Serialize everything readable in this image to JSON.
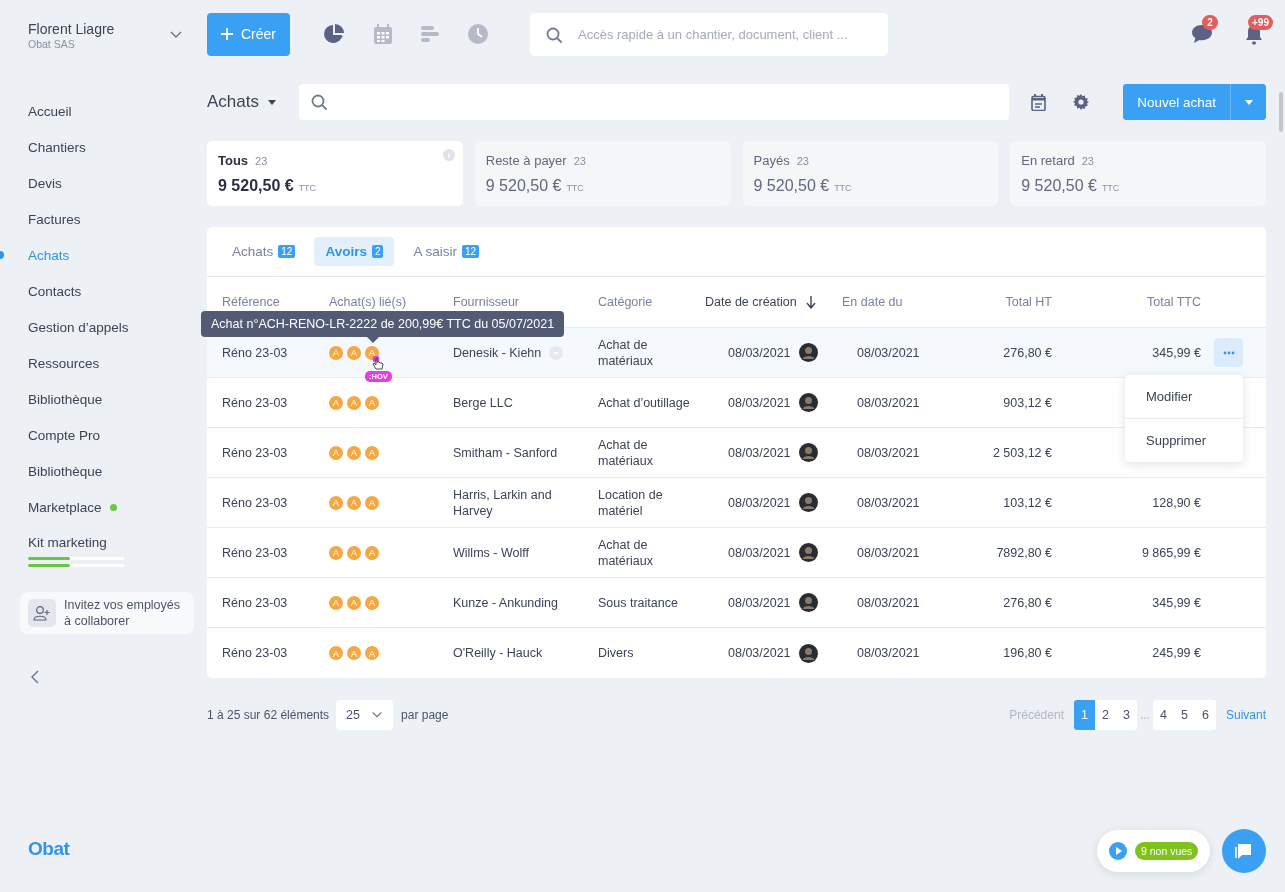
{
  "user": {
    "name": "Florent Liagre",
    "company": "Obat SAS"
  },
  "sidebar": {
    "items": [
      {
        "label": "Accueil",
        "selected": false
      },
      {
        "label": "Chantiers",
        "selected": false
      },
      {
        "label": "Devis",
        "selected": false
      },
      {
        "label": "Factures",
        "selected": false
      },
      {
        "label": "Achats",
        "selected": true
      },
      {
        "label": "Contacts",
        "selected": false
      },
      {
        "label": "Gestion d’appels",
        "selected": false
      },
      {
        "label": "Ressources",
        "selected": false
      },
      {
        "label": "Bibliothèque",
        "selected": false
      },
      {
        "label": "Compte Pro",
        "selected": false
      },
      {
        "label": "Bibliothèque",
        "selected": false
      },
      {
        "label": "Marketplace",
        "selected": false,
        "color": "#6cc644"
      },
      {
        "label": "Kit marketing",
        "selected": false,
        "progress": [
          {
            "level": 0.44
          },
          {
            "level": 0.44
          }
        ]
      }
    ],
    "invite": "Invitez vos employés à collaborer",
    "logo": "Obat"
  },
  "topbar": {
    "create_button": "Créer",
    "search_placeholder": "Accès rapide à un chantier, document, client ...",
    "messages_badge": "2",
    "notifications_badge": "+99"
  },
  "header": {
    "title": "Achats",
    "new_button": "Nouvel achat"
  },
  "cards": [
    {
      "label": "Tous",
      "count": "23",
      "amount": "9 520,50 €",
      "unit": "TTC",
      "selected": true
    },
    {
      "label": "Reste à payer",
      "count": "23",
      "amount": "9 520,50 €",
      "unit": "TTC",
      "selected": false
    },
    {
      "label": "Payés",
      "count": "23",
      "amount": "9 520,50 €",
      "unit": "TTC",
      "selected": false
    },
    {
      "label": "En retard",
      "count": "23",
      "amount": "9 520,50 €",
      "unit": "TTC",
      "selected": false
    }
  ],
  "tabs": [
    {
      "label": "Achats",
      "count": "12",
      "selected": false
    },
    {
      "label": "Avoirs",
      "count": "2",
      "selected": true
    },
    {
      "label": "A saisir",
      "count": "12",
      "selected": false
    }
  ],
  "table": {
    "columns": [
      {
        "label": "Référence",
        "sorted": false
      },
      {
        "label": "Achat(s) lié(s)",
        "sorted": false
      },
      {
        "label": "Fournisseur",
        "sorted": false
      },
      {
        "label": "Catégorie",
        "sorted": false
      },
      {
        "label": "Date de création",
        "sorted": true
      },
      {
        "label": "En date du",
        "sorted": false
      },
      {
        "label": "Total HT",
        "sorted": false
      },
      {
        "label": "Total TTC",
        "sorted": false
      }
    ],
    "rows": [
      {
        "reference": "Réno 23-03",
        "linked": [
          "A",
          "A",
          "A"
        ],
        "supplier": "Denesik - Kiehn",
        "category": "Achat de matériaux",
        "created": "08/03/2021",
        "date": "08/03/2021",
        "total_ht": "276,80 €",
        "total_ttc": "345,99 €",
        "selected": true
      },
      {
        "reference": "Réno 23-03",
        "linked": [
          "A",
          "A",
          "A"
        ],
        "supplier": "Berge LLC",
        "category": "Achat d’outillage",
        "created": "08/03/2021",
        "date": "08/03/2021",
        "total_ht": "903,12 €",
        "selected": false
      },
      {
        "reference": "Réno 23-03",
        "linked": [
          "A",
          "A",
          "A"
        ],
        "supplier": "Smitham - Sanford",
        "category": "Achat de matériaux",
        "created": "08/03/2021",
        "date": "08/03/2021",
        "total_ht": "2 503,12 €",
        "selected": false
      },
      {
        "reference": "Réno 23-03",
        "linked": [
          "A",
          "A",
          "A"
        ],
        "supplier": "Harris, Larkin and Harvey",
        "category": "Location de matériel",
        "created": "08/03/2021",
        "date": "08/03/2021",
        "total_ht": "103,12 €",
        "total_ttc": "128,90 €",
        "selected": false
      },
      {
        "reference": "Réno 23-03",
        "linked": [
          "A",
          "A",
          "A"
        ],
        "supplier": "Willms - Wolff",
        "category": "Achat de matériaux",
        "created": "08/03/2021",
        "date": "08/03/2021",
        "total_ht": "7892,80 €",
        "total_ttc": "9 865,99 €",
        "selected": false
      },
      {
        "reference": "Réno 23-03",
        "linked": [
          "A",
          "A",
          "A"
        ],
        "supplier": "Kunze - Ankunding",
        "category": "Sous traitance",
        "created": "08/03/2021",
        "date": "08/03/2021",
        "total_ht": "276,80 €",
        "total_ttc": "345,99 €",
        "selected": false
      },
      {
        "reference": "Réno 23-03",
        "linked": [
          "A",
          "A",
          "A"
        ],
        "supplier": "O'Reilly - Hauck",
        "category": "Divers",
        "created": "08/03/2021",
        "date": "08/03/2021",
        "total_ht": "196,80 €",
        "total_ttc": "245,99 €",
        "selected": false
      }
    ],
    "tooltip": "Achat n°ACH-RENO-LR-2222 de 200,99€ TTC du 05/07/2021",
    "hover_badge": ":HOV",
    "menu": [
      "Modifier",
      "Supprimer"
    ]
  },
  "pagination": {
    "summary": "1 à 25 sur 62 éléments",
    "per_page": "25",
    "per_page_label": "par page",
    "previous": "Précédent",
    "pages": [
      {
        "kind": "page",
        "label": "1",
        "selected": true
      },
      {
        "kind": "page",
        "label": "2",
        "selected": false
      },
      {
        "kind": "page",
        "label": "3",
        "selected": false
      },
      {
        "kind": "ellipsis",
        "label": "..."
      },
      {
        "kind": "page",
        "label": "4",
        "selected": false
      },
      {
        "kind": "page",
        "label": "5",
        "selected": false
      },
      {
        "kind": "page",
        "label": "6",
        "selected": false
      }
    ],
    "next": "Suivant"
  },
  "widget": {
    "unseen": "9 non vues"
  }
}
